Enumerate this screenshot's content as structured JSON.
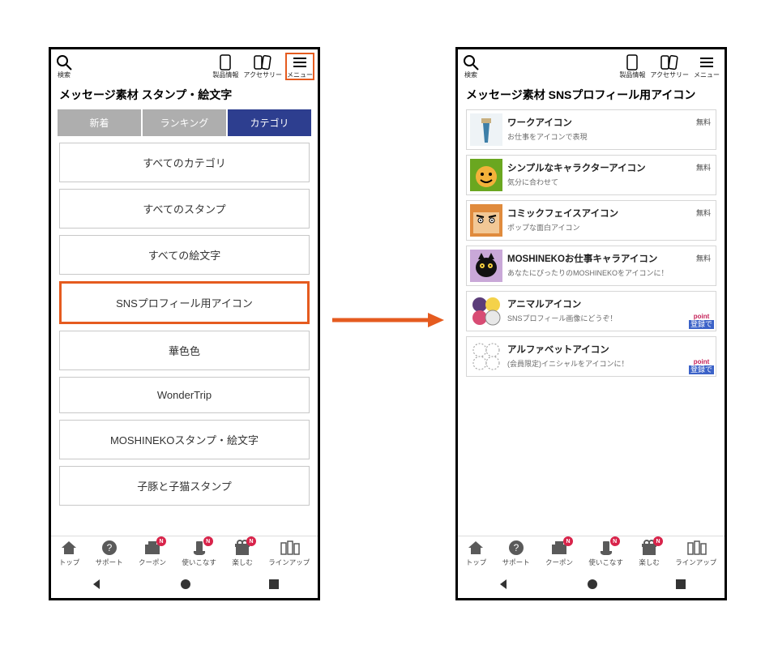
{
  "left": {
    "topbar": {
      "search": "検索",
      "product": "製品情報",
      "accessory": "アクセサリー",
      "menu": "メニュー"
    },
    "title": "メッセージ素材 スタンプ・絵文字",
    "tabs": {
      "new": "新着",
      "ranking": "ランキング",
      "category": "カテゴリ"
    },
    "categories": [
      "すべてのカテゴリ",
      "すべてのスタンプ",
      "すべての絵文字",
      "SNSプロフィール用アイコン",
      "華色色",
      "WonderTrip",
      "MOSHINEKOスタンプ・絵文字",
      "子豚と子猫スタンプ"
    ],
    "bottom": {
      "top": "トップ",
      "support": "サポート",
      "coupon": "クーポン",
      "howto": "使いこなす",
      "enjoy": "楽しむ",
      "lineup": "ラインアップ",
      "badge": "N"
    }
  },
  "right": {
    "topbar": {
      "search": "検索",
      "product": "製品情報",
      "accessory": "アクセサリー",
      "menu": "メニュー"
    },
    "title": "メッセージ素材 SNSプロフィール用アイコン",
    "items": [
      {
        "title": "ワークアイコン",
        "sub": "お仕事をアイコンで表現",
        "tag": "無料"
      },
      {
        "title": "シンプルなキャラクターアイコン",
        "sub": "気分に合わせて",
        "tag": "無料"
      },
      {
        "title": "コミックフェイスアイコン",
        "sub": "ポップな面白アイコン",
        "tag": "無料"
      },
      {
        "title": "MOSHINEKOお仕事キャラアイコン",
        "sub": "あなたにぴったりのMOSHINEKOをアイコンに！",
        "tag": "無料"
      },
      {
        "title": "アニマルアイコン",
        "sub": "SNSプロフィール画像にどうぞ！",
        "tag": "point"
      },
      {
        "title": "アルファベットアイコン",
        "sub": "(会員限定)イニシャルをアイコンに！",
        "tag": "point"
      }
    ],
    "pointBadge": {
      "pt": "point",
      "rg": "登録で"
    },
    "bottom": {
      "top": "トップ",
      "support": "サポート",
      "coupon": "クーポン",
      "howto": "使いこなす",
      "enjoy": "楽しむ",
      "lineup": "ラインアップ",
      "badge": "N"
    }
  }
}
